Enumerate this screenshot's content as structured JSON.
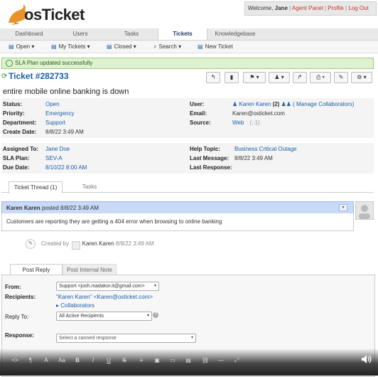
{
  "header": {
    "logo_text": "osTicket",
    "welcome_prefix": "Welcome,",
    "user_name": "Jane",
    "agent_panel": "Agent Panel",
    "profile": "Profile",
    "logout": "Log Out",
    "separator": "|"
  },
  "nav": {
    "tabs": [
      "Dashboard",
      "Users",
      "Tasks",
      "Tickets",
      "Knowledgebase"
    ],
    "active": "Tickets"
  },
  "subnav": {
    "open": "Open",
    "my_tickets": "My Tickets",
    "closed": "Closed",
    "search": "Search",
    "new_ticket": "New Ticket"
  },
  "alert": {
    "message": "SLA Plan updated successfully"
  },
  "ticket": {
    "number": "Ticket #282733",
    "subject": "entire mobile online banking is down"
  },
  "info": {
    "status_label": "Status:",
    "status": "Open",
    "priority_label": "Priority:",
    "priority": "Emergency",
    "department_label": "Department:",
    "department": "Support",
    "create_date_label": "Create Date:",
    "create_date": "8/8/22 3:49 AM",
    "user_label": "User:",
    "user": "Karen Karen",
    "user_count": "(2)",
    "manage_collaborators": "( Manage Collaborators)",
    "email_label": "Email:",
    "email": "Karen@osticket.com",
    "source_label": "Source:",
    "source": "Web",
    "source_extra": "(::1)",
    "assigned_label": "Assigned To:",
    "assigned": "Jane Doe",
    "sla_label": "SLA Plan:",
    "sla": "SEV-A",
    "due_label": "Due Date:",
    "due": "8/10/22 8:00 AM",
    "help_topic_label": "Help Topic:",
    "help_topic": "Business Critical Outage",
    "last_message_label": "Last Message:",
    "last_message": "8/8/22 3:49 AM",
    "last_response_label": "Last Response:",
    "last_response": ""
  },
  "thread": {
    "tab_thread": "Ticket Thread (1)",
    "tab_tasks": "Tasks",
    "author": "Karen Karen",
    "posted": "posted 8/8/22 3:49 AM",
    "body": "Customers are reporting they are getting a 404 error when browsing to online banking",
    "created_by_label": "Created by",
    "created_by_name": "Karen Karen",
    "created_by_time": "8/8/22 3:49 AM"
  },
  "reply": {
    "tab_post": "Post Reply",
    "tab_note": "Post Internal Note",
    "from_label": "From:",
    "from_value": "Support <josh.madakor.it@gmail.com>",
    "recipients_label": "Recipients:",
    "recipients_value": "\"Karen Karen\" <Karen@osticket.com>",
    "collaborators": "Collaborators",
    "reply_to_label": "Reply To:",
    "reply_to_value": "All Active Recipients",
    "response_label": "Response:",
    "response_placeholder": "Select a canned response"
  },
  "editor": {
    "tools": [
      "<>",
      "¶",
      "A",
      "Aa",
      "B",
      "I",
      "U",
      "S",
      "≡",
      "▣",
      "▭",
      "▤",
      "⛓",
      "—",
      "⤢"
    ]
  }
}
